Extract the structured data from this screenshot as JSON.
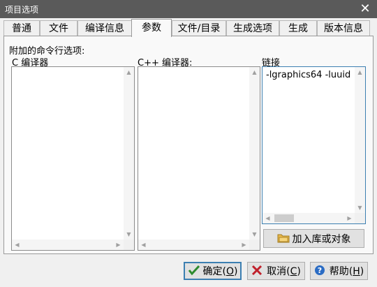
{
  "window": {
    "title": "项目选项",
    "close_glyph": "✕"
  },
  "tabs": [
    {
      "label": "普通",
      "active": false
    },
    {
      "label": "文件",
      "active": false
    },
    {
      "label": "编译信息",
      "active": false
    },
    {
      "label": "参数",
      "active": true
    },
    {
      "label": "文件/目录",
      "active": false
    },
    {
      "label": "生成选项",
      "active": false
    },
    {
      "label": "生成",
      "active": false
    },
    {
      "label": "版本信息",
      "active": false
    }
  ],
  "panel": {
    "heading": "附加的命令行选项:",
    "c_compiler_label": "C 编译器",
    "cpp_compiler_label": "C++ 编译器:",
    "linker_label": "链接",
    "c_compiler_value": "",
    "cpp_compiler_value": "",
    "linker_value": "-lgraphics64 -luuid",
    "add_lib_label": "加入库或对象"
  },
  "buttons": {
    "ok": {
      "label": "确定(",
      "hotkey": "O",
      "suffix": ")"
    },
    "cancel": {
      "label": "取消(",
      "hotkey": "C",
      "suffix": ")"
    },
    "help": {
      "label": "帮助(",
      "hotkey": "H",
      "suffix": ")"
    }
  },
  "icons": {
    "ok": "checkmark-icon",
    "cancel": "x-icon",
    "help": "question-mark-icon",
    "add_lib": "folder-icon"
  },
  "colors": {
    "titlebar": "#5a5a5a",
    "focus_border": "#3c7fb1",
    "cancel_red": "#c0202b",
    "help_blue": "#2b6cc4",
    "ok_green": "#2d8a2d"
  }
}
